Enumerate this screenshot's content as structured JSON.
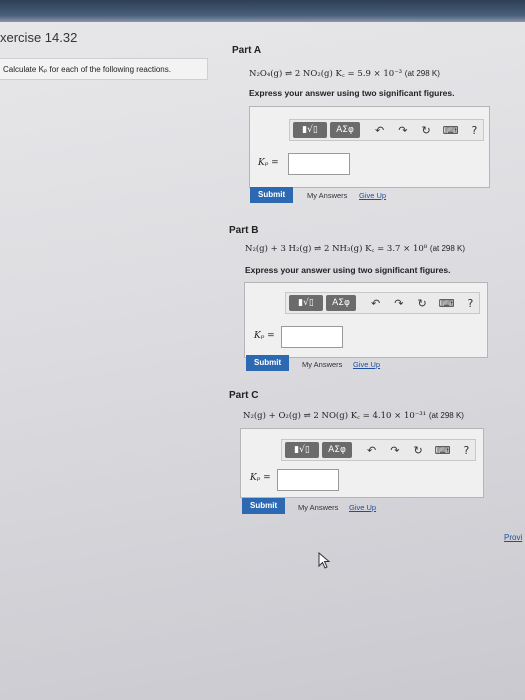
{
  "header": {
    "title": "xercise 14.32"
  },
  "instruction": "Calculate Kₚ for each of the following reactions.",
  "toolbar": {
    "template_label": "▮√▯",
    "greek_label": "ΑΣφ",
    "undo": "↶",
    "redo": "↷",
    "reset": "↻",
    "keyboard": "⌨",
    "help": "?"
  },
  "kp_label": "Kₚ =",
  "express": "Express your answer using two significant figures.",
  "actions": {
    "submit": "Submit",
    "my_answers": "My Answers",
    "give_up": "Give Up"
  },
  "parts": [
    {
      "label": "Part A",
      "equation": "N₂O₄(g) ⇌ 2 NO₂(g)   K꜀ = 5.9 × 10⁻³",
      "note": "(at 298 K)"
    },
    {
      "label": "Part B",
      "equation": "N₂(g) + 3 H₂(g) ⇌ 2 NH₃(g)   K꜀ = 3.7 × 10⁸",
      "note": "(at 298 K)"
    },
    {
      "label": "Part C",
      "equation": "N₂(g) + O₂(g) ⇌ 2 NO(g)   K꜀ = 4.10 × 10⁻³¹",
      "note": "(at 298 K)"
    }
  ],
  "footer": {
    "provide": "Provi"
  }
}
